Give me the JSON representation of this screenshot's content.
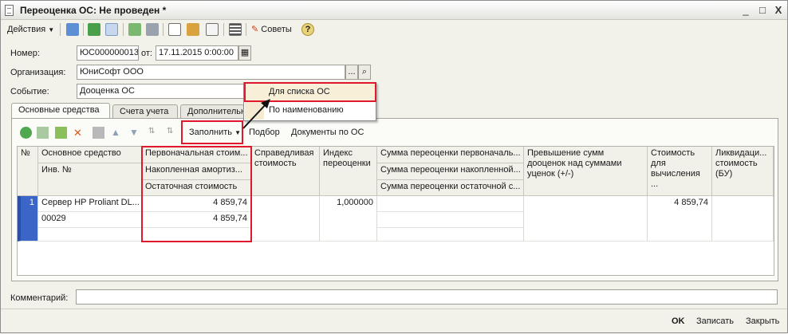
{
  "window": {
    "title": "Переоценка ОС: Не проведен *",
    "minimize": "_",
    "maximize": "□",
    "close": "X"
  },
  "toolbar": {
    "actions_label": "Действия",
    "tips_label": "Советы",
    "help_glyph": "?"
  },
  "form": {
    "number_label": "Номер:",
    "number_value": "ЮС000000013",
    "from_label": "от:",
    "date_value": "17.11.2015  0:00:00",
    "org_label": "Организация:",
    "org_value": "ЮниСофт ООО",
    "event_label": "Событие:",
    "event_value": "Дооценка ОС",
    "comment_label": "Комментарий:",
    "comment_value": ""
  },
  "tabs": [
    {
      "label": "Основные средства"
    },
    {
      "label": "Счета учета"
    },
    {
      "label": "Дополнительно"
    }
  ],
  "grid_toolbar": {
    "fill_label": "Заполнить",
    "select_label": "Подбор",
    "docs_label": "Документы по ОС"
  },
  "fill_menu": {
    "items": [
      "Для списка ОС",
      "По наименованию"
    ]
  },
  "table": {
    "headers": {
      "num": "№",
      "asset": "Основное средство",
      "inv": "Инв. №",
      "initial_cost": "Первоначальная стоим...",
      "accum_depr": "Накопленная амортиз...",
      "residual": "Остаточная стоимость",
      "fair_value": "Справедливая стоимость",
      "index": "Индекс переоценки",
      "reval_initial": "Сумма переоценки первоначаль...",
      "reval_accum": "Сумма переоценки накопленной...",
      "reval_residual": "Сумма переоценки остаточной с...",
      "excess": "Превышение сумм дооценок над суммами уценок (+/-)",
      "cost_calc": "Стоимость для вычисления ...",
      "liquid": "Ликвидаци... стоимость (БУ)"
    },
    "rows": [
      {
        "num": "1",
        "asset": "Сервер HP Proliant DL...",
        "inv": "00029",
        "initial_cost": "4 859,74",
        "accum_depr": "4 859,74",
        "residual": "",
        "index": "1,000000",
        "cost_calc": "4 859,74"
      }
    ]
  },
  "buttons": {
    "ok": "OK",
    "save": "Записать",
    "close": "Закрыть"
  },
  "colors": {
    "highlight": "#e0182b",
    "row_marker": "#3b66c8"
  }
}
